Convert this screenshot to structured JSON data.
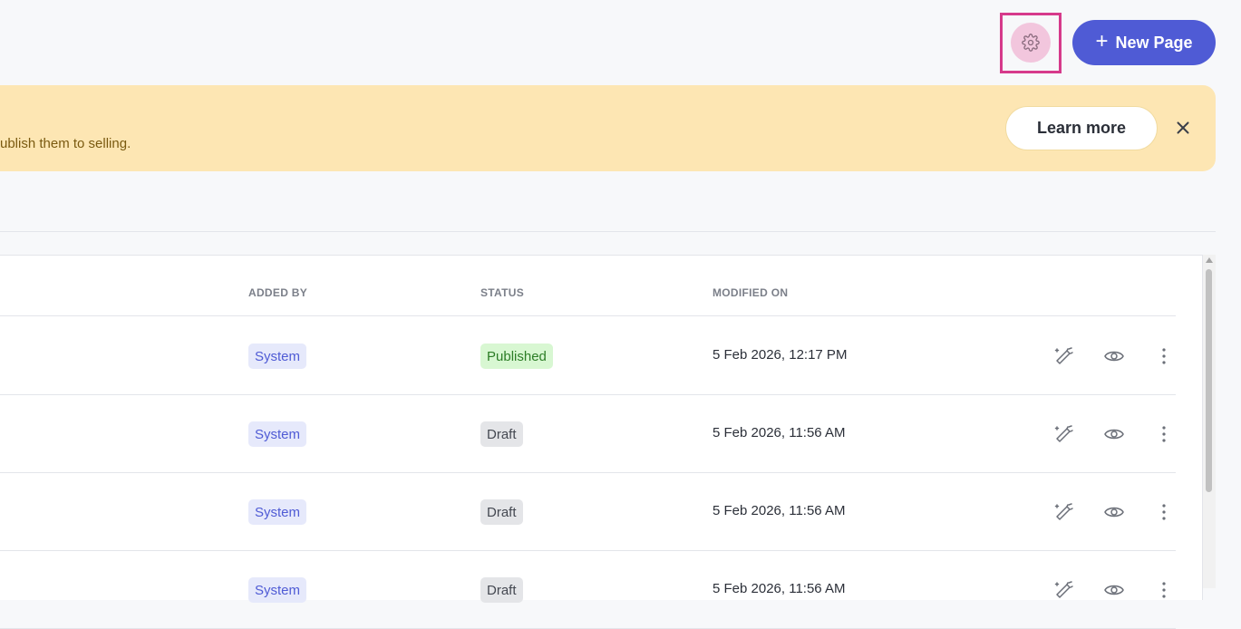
{
  "header": {
    "settings_icon": "gear-icon",
    "new_page_label": "New Page",
    "new_page_icon": "plus-icon"
  },
  "banner": {
    "text": "ublish them to selling.",
    "learn_more_label": "Learn more",
    "close_icon": "close-icon"
  },
  "table": {
    "columns": [
      "ADDED BY",
      "STATUS",
      "MODIFIED ON"
    ],
    "rows": [
      {
        "added_by": "System",
        "status": "Published",
        "modified_on": "5 Feb 2026, 12:17 PM"
      },
      {
        "added_by": "System",
        "status": "Draft",
        "modified_on": "5 Feb 2026, 11:56 AM"
      },
      {
        "added_by": "System",
        "status": "Draft",
        "modified_on": "5 Feb 2026, 11:56 AM"
      },
      {
        "added_by": "System",
        "status": "Draft",
        "modified_on": "5 Feb 2026, 11:56 AM"
      }
    ],
    "row_actions": [
      "magic-edit-icon",
      "eye-icon",
      "more-vertical-icon"
    ]
  },
  "colors": {
    "primary": "#4f5bd5",
    "banner_bg": "#fde6b3",
    "highlight": "#d63a8b",
    "published_bg": "#d8f7d2",
    "draft_bg": "#e4e5e8"
  }
}
